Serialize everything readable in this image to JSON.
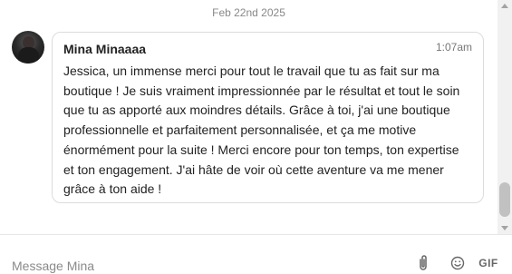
{
  "conversation": {
    "date_separator": "Feb 22nd 2025",
    "message": {
      "sender": "Mina Minaaaa",
      "time": "1:07am",
      "text": "Jessica, un immense merci pour tout le travail que tu as fait sur ma boutique ! Je suis vraiment impressionnée par le résultat et tout le soin que tu as apporté aux moindres détails. Grâce à toi, j'ai une boutique professionnelle et parfaitement personnalisée, et ça me motive énormément pour la suite ! Merci encore pour ton temps, ton expertise et ton engagement. J'ai hâte de voir où cette aventure va me mener grâce à ton aide !"
    }
  },
  "composer": {
    "placeholder": "Message Mina",
    "gif_label": "GIF",
    "icons": [
      "paperclip-icon",
      "emoji-icon",
      "gif-icon"
    ]
  }
}
